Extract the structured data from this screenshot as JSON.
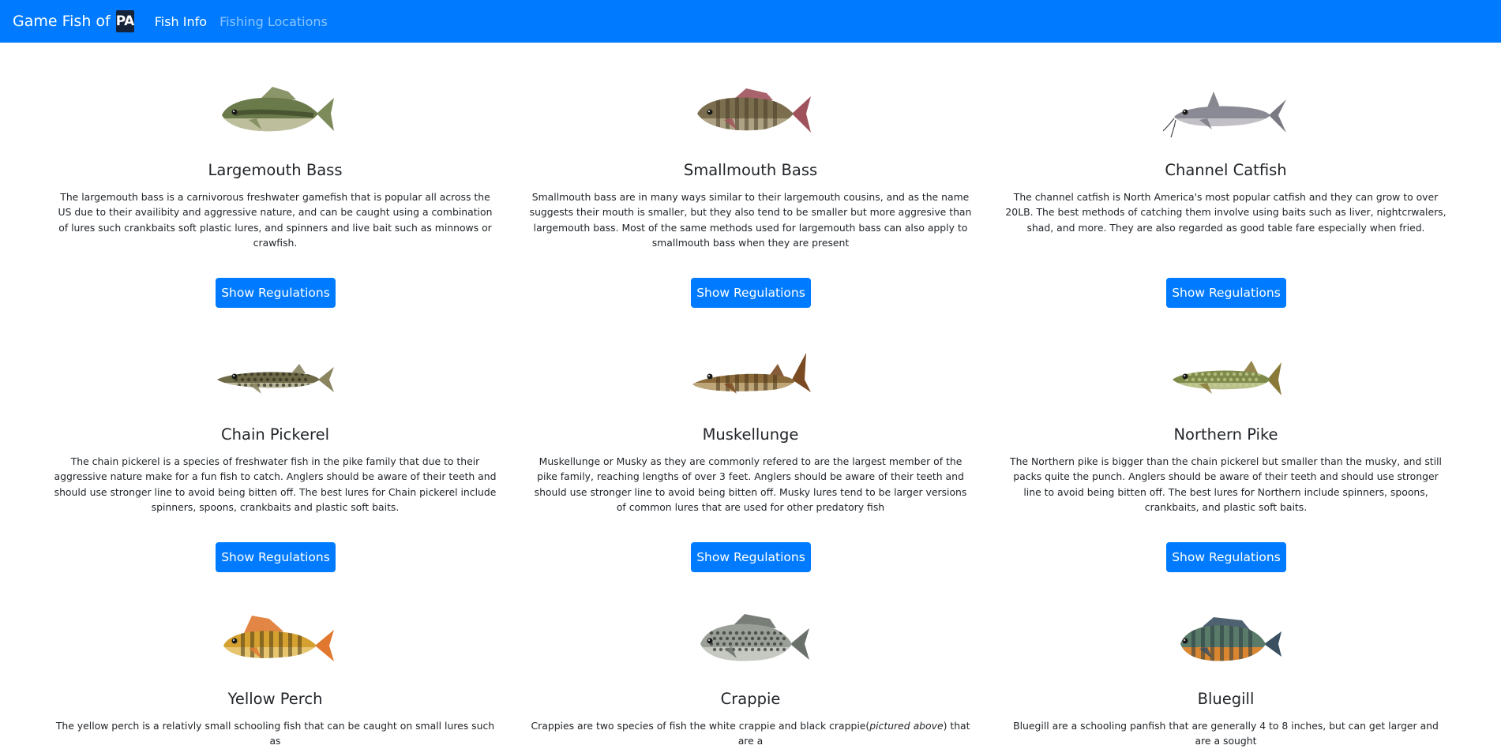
{
  "nav": {
    "brand_text": "Game Fish of",
    "brand_logo_text": "PA",
    "links": [
      {
        "label": "Fish Info",
        "active": true
      },
      {
        "label": "Fishing Locations",
        "active": false
      }
    ]
  },
  "fish": [
    {
      "name": "Largemouth Bass",
      "image": "largemouth-bass-image",
      "desc": "The largemouth bass is a carnivorous freshwater gamefish that is popular all across the US due to their availibity and aggressive nature, and can be caught using a combination of lures such crankbaits soft plastic lures, and spinners and live bait such as minnows or crawfish.",
      "button": "Show Regulations",
      "colors": {
        "body": "#6b7a4a",
        "belly": "#e8e4c8",
        "marks": "#3a4426",
        "fin": "#7d8a5a"
      }
    },
    {
      "name": "Smallmouth Bass",
      "image": "smallmouth-bass-image",
      "desc": "Smallmouth bass are in many ways similar to their largemouth cousins, and as the name suggests their mouth is smaller, but they also tend to be smaller but more aggresive than largemouth bass. Most of the same methods used for largemouth bass can also apply to smallmouth bass when they are present",
      "button": "Show Regulations",
      "colors": {
        "body": "#7a6e4e",
        "belly": "#c9bea0",
        "marks": "#4a3e28",
        "fin": "#a0525c"
      }
    },
    {
      "name": "Channel Catfish",
      "image": "channel-catfish-image",
      "desc": "The channel catfish is North America's most popular catfish and they can grow to over 20LB. The best methods of catching them involve using baits such as liver, nightcrwalers, shad, and more. They are also regarded as good table fare especially when fried.",
      "button": "Show Regulations",
      "colors": {
        "body": "#8a8a94",
        "belly": "#e0dde0",
        "marks": "#5a5a64",
        "fin": "#7a7a84"
      }
    },
    {
      "name": "Chain Pickerel",
      "image": "chain-pickerel-image",
      "desc": "The chain pickerel is a species of freshwater fish in the pike family that due to their aggressive nature make for a fun fish to catch. Anglers should be aware of their teeth and should use stronger line to avoid being bitten off. The best lures for Chain pickerel include spinners, spoons, crankbaits and plastic soft baits.",
      "button": "Show Regulations",
      "colors": {
        "body": "#6e6a48",
        "belly": "#e4e0c8",
        "marks": "#2e2c1c",
        "fin": "#8a8460"
      }
    },
    {
      "name": "Muskellunge",
      "image": "muskellunge-image",
      "desc": "Muskellunge or Musky as they are commonly refered to are the largest member of the pike family, reaching lengths of over 3 feet. Anglers should be aware of their teeth and should use stronger line to avoid being bitten off. Musky lures tend to be larger versions of common lures that are used for other predatory fish",
      "button": "Show Regulations",
      "colors": {
        "body": "#8a6a3a",
        "belly": "#d8c49a",
        "marks": "#4a3418",
        "fin": "#7a4a22"
      }
    },
    {
      "name": "Northern Pike",
      "image": "northern-pike-image",
      "desc": "The Northern pike is bigger than the chain pickerel but smaller than the musky, and still packs quite the punch. Anglers should be aware of their teeth and should use stronger line to avoid being bitten off. The best lures for Northern include spinners, spoons, crankbaits, and plastic soft baits.",
      "button": "Show Regulations",
      "colors": {
        "body": "#7e8a4a",
        "belly": "#d8dcae",
        "marks": "#c8d090",
        "fin": "#8a7a3a"
      }
    },
    {
      "name": "Yellow Perch",
      "image": "yellow-perch-image",
      "desc": "The yellow perch is a relativly small schooling fish that can be caught on small lures such as",
      "button": "Show Regulations",
      "colors": {
        "body": "#d4a030",
        "belly": "#f0d890",
        "marks": "#4a3a18",
        "fin": "#e07830"
      }
    },
    {
      "name": "Crappie",
      "image": "crappie-image",
      "desc_before": "Crappies are two species of fish the white crappie and black crappie(",
      "desc_em": "pictured above",
      "desc_after": ") that are a",
      "button": "Show Regulations",
      "colors": {
        "body": "#9aa098",
        "belly": "#dcdfd8",
        "marks": "#2c322c",
        "fin": "#6a706a"
      }
    },
    {
      "name": "Bluegill",
      "image": "bluegill-image",
      "desc": "Bluegill are a schooling panfish that are generally 4 to 8 inches, but can get larger and are a sought",
      "button": "Show Regulations",
      "colors": {
        "body": "#5a7a6a",
        "belly": "#e8862a",
        "marks": "#2a3a40",
        "fin": "#3a5060"
      }
    }
  ]
}
